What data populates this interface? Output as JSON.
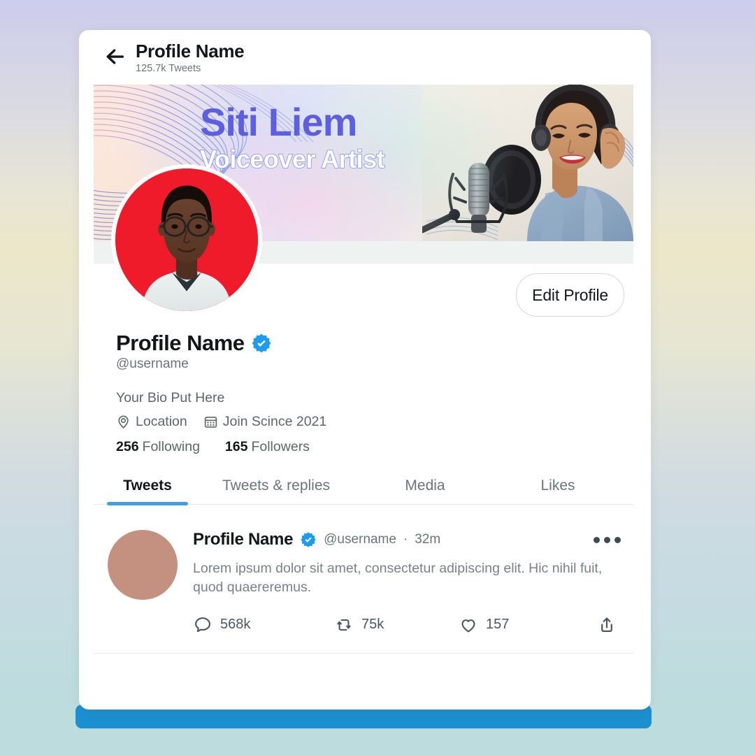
{
  "header": {
    "back_icon": "back-arrow-icon",
    "title": "Profile Name",
    "subtitle": "125.7k Tweets"
  },
  "banner": {
    "name": "Siti Liem",
    "subtitle": "Voiceover Artist",
    "name_color": "#5b5fe0",
    "photo_alt": "woman-with-headphones-at-microphone"
  },
  "profile": {
    "edit_button": "Edit Profile",
    "display_name": "Profile Name",
    "verified": true,
    "handle": "@username",
    "bio": "Your Bio Put Here",
    "location_icon": "location-pin-icon",
    "location": "Location",
    "calendar_icon": "calendar-icon",
    "joined": "Join Scince 2021",
    "following_count": "256",
    "following_label": "Following",
    "followers_count": "165",
    "followers_label": "Followers",
    "avatar_bg": "#ef1b2b"
  },
  "tabs": [
    {
      "label": "Tweets",
      "active": true
    },
    {
      "label": "Tweets & replies",
      "active": false
    },
    {
      "label": "Media",
      "active": false
    },
    {
      "label": "Likes",
      "active": false
    }
  ],
  "tab_accent": "#3fa0e8",
  "tweets": [
    {
      "name": "Profile Name",
      "verified": true,
      "handle": "@username",
      "separator": "·",
      "time": "32m",
      "text": "Lorem ipsum dolor sit amet, consectetur adipiscing elit. Hic nihil fuit, quod quaereremus.",
      "avatar_color": "#c4907f",
      "actions": {
        "reply_icon": "comment-icon",
        "reply_count": "568k",
        "retweet_icon": "retweet-icon",
        "retweet_count": "75k",
        "like_icon": "heart-icon",
        "like_count": "157",
        "share_icon": "share-icon"
      },
      "more_icon": "more-options-icon"
    }
  ],
  "footer_bar_color": "#1c8fd0"
}
